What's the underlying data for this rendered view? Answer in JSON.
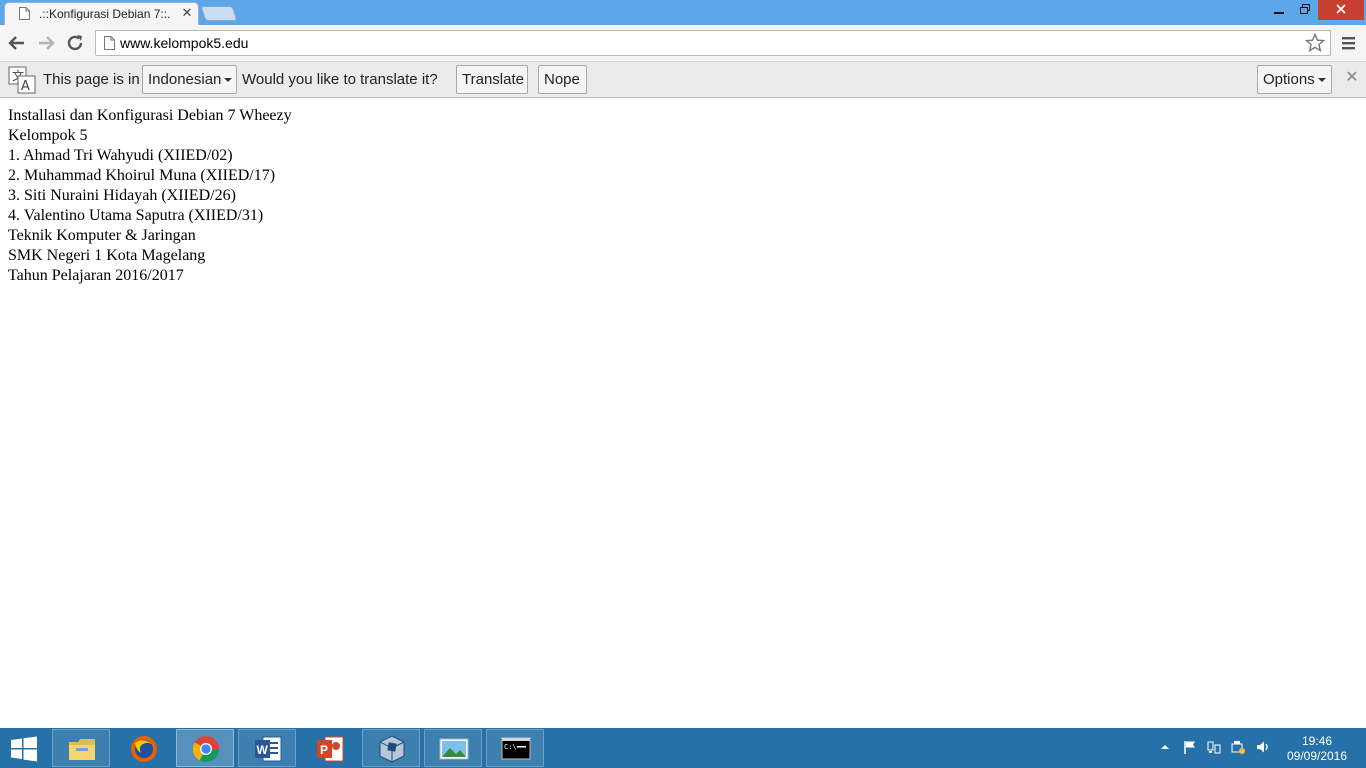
{
  "browser": {
    "tab_title": ".::Konfigurasi Debian 7::.",
    "url": "www.kelompok5.edu"
  },
  "translate_bar": {
    "prefix": "This page is in",
    "language": "Indonesian",
    "question": "Would you like to translate it?",
    "translate_label": "Translate",
    "nope_label": "Nope",
    "options_label": "Options"
  },
  "page": {
    "lines": [
      "Installasi dan Konfigurasi Debian 7 Wheezy",
      "Kelompok 5",
      "1. Ahmad Tri Wahyudi (XIIED/02)",
      "2. Muhammad Khoirul Muna (XIIED/17)",
      "3. Siti Nuraini Hidayah (XIIED/26)",
      "4. Valentino Utama Saputra (XIIED/31)",
      "Teknik Komputer & Jaringan",
      "SMK Negeri 1 Kota Magelang",
      "Tahun Pelajaran 2016/2017"
    ]
  },
  "taskbar": {
    "apps": [
      "file-explorer-icon",
      "firefox-icon",
      "chrome-icon",
      "word-icon",
      "powerpoint-icon",
      "virtualbox-icon",
      "photos-icon",
      "command-prompt-icon"
    ],
    "clock_time": "19:46",
    "clock_date": "09/09/2016"
  },
  "colors": {
    "titlebar": "#5ca6ea",
    "taskbar": "#2672a8",
    "close_button": "#c84031"
  }
}
